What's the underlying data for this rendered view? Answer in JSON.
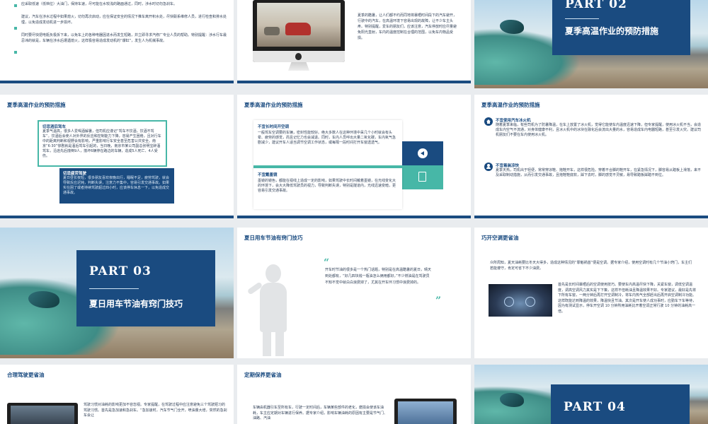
{
  "slides": {
    "s1": {
      "p1": "应采取低速（低档位）大油门，保持车速，尽可能在水较浅的路面通过，同时，涉水时切勿急刹车。",
      "p2": "建议，汽车在涉水过程中如果熄火，切勿再次启动，应在保证安全的情况下推车离开积水处，尽快联系维修人员，进行检查和排水处理，以免造成发动机进一步损坏。",
      "p3": "同时要尽快把电瓶负极拆下来，以免车上的各种电器因进水而发生短路，并立即寻求汽修厂专业人员的帮助。特别提醒：涉水行车最忌讳的就是，车辆在涉水后遭遇熄火，这样极容易造成发动机的“爆缸”，发生人为机械事故。"
    },
    "s2": {
      "text": "夏季的酷暑，让人们都不约而同地将暴晒时间段下的汽车避开，行驶中的汽车，在高温环境下容易出现的故障，让不少车主头疼。特别提醒，爱车的朋友们，应该注意，汽车停放时应尽量避免阳光直射，车内的温度控制在合理的范围，以免车内物品受损。"
    },
    "s3": {
      "part": "PART  02",
      "title": "夏季高温作业的预防措施"
    },
    "s4": {
      "title": "夏季高温作业的预防措施",
      "box1_head": "切忌酒后驾车",
      "box1_text": "夏季气温高，很多人爱喝酒解暑，但司机应谨记“驾车不饮酒，饮酒不驾车”。饮酒后会使人对外界的反应和控制能力下降，容易产生困倦，且对行车中的距离判断和视野会有影响，严重影响行车安全甚至危害公共安全。南京“6·30”惨剧就是酒后驾车引起的，当日晚，南京市某公司副总张明宝醉酒驾车，沿途先后撞倒9人，撞坏6辆停在路边的车辆，造成5人死亡、4人受伤。",
      "box2_head": "切忌疲劳驾驶",
      "box2_text": "夏日昼长夜短，很多朋友喜欢夜晚出行，睡眠不足，疲劳驾驶，就会导致反应迟钝，判断失误，注意力不集中，容易引发交通事故。如果实在困了或者持续驾驶超过四小时，应该停车休息一下，以免造成交通事故。"
    },
    "s5": {
      "title": "夏季高温作业的预防措施",
      "box1_head": "不宜长时间开空调",
      "box1_text": "一般驾车空调要的车辆，密封性能较好。绝大多数人在这种环境中呆几个小时就会有头晕、疲劳的感觉，而且记忆力也会减退。同时，车内人员呼出大量二氧化碳，车内氧气急剧减少，建议开车人适当调节空调工作状态，或每隔一段时间打开车窗透透气。",
      "box2_head": "不宜戴墨镜",
      "box2_text": "墨镜的镜色，都能在视线上造成一定的影响，如果驾驶中长时间戴着墨镜，在光线变化大的环境下，会大大降低驾驶员的视力，导致判断失误，特别是隧道内，光线迅速变暗，更容易引发交通事故。"
    },
    "s6": {
      "title": "夏季高温作业的预防措施",
      "item1_head": "不宜使用汽车冰火机",
      "item1_text": "随着夏季来临，有些司机为了防暑降温，在车上放置了冰火机，觉得它能使车内温度迅速下降，但专家提醒，使用冰火机不当，会造成车内空气不流通，对身体健康不利，且冰火机中的冰块在融化后会流出大量的水，容易造成车内电器短路，甚至引发火灾。建议司机朋友们不要在车内使用冰火机。",
      "item2_head": "不宜着装凉快",
      "item2_text": "夏季天热，司机出于轻便，常常穿凉鞋、拖鞋开车，这样很危险。穿着不合脚的鞋开车，在紧急情况下，脚容易从踏板上滑落，来不及采取制动措施，从而引发交通事故，且拖鞋鞋底软，踩下去时，脚的感觉不灵敏，易导致踏板踩踏不到位。"
    },
    "s7": {
      "part": "PART  03",
      "title": "夏日用车节油有窍门技巧"
    },
    "s8": {
      "title": "夏日用车节油有窍门技巧",
      "quote_text": "开车时节油的很多是一个热门话题，特别是在高温酷暑的夏日，晴天到处都有，“好几四块钱一瓶油怎么俩用都好，”不少燃油是在驾驶员不知不觉中就白白浪费掉了，尤其在开车环习惯中浪费掉的。"
    },
    "s9": {
      "title": "巧开空调更省油",
      "p1": "众所周知，夏天油耗要比冬天大得多，造成这种情况的“罪魁祸首”便是空调。据专家介绍，使用空调时有几个节油小窍门，车主们若能遵守，肯定可省下不少油费。",
      "p2": "首先是长时间暴晒后的空调使用技巧。要使车内高温尽快下降，关紧车窗，调低空调温度，调高空调风力其实是下下策，这样不但耗油且降温效果不好。专家建议，最好是先将下所有车窗，一两分钟后再打开空调制冷，将车内热气全部赶出后再开启空调制冷功能。这样既能达到降温的效果，降温快且节油。其次是开车使人成功事时，应勤车下车等待，因为有测试显示，停车开空调 10 分钟所用油耗比开着空调正常行驶 10 分钟的油耗高一倍。"
    },
    "s10": {
      "title": "合理驾驶更省油",
      "text": "驾驶习惯对油耗的影响更加不容忽视。专家提醒，在驾驶过程中应注意避免三个驾驶陋习的驾驶习惯。首先是急加速和急刹车。“急加速时，汽车节气门全开，喷油量大增，突然的急刹车会让"
    },
    "s11": {
      "title": "定期保养更省油",
      "text": "车辆由机器引车至所有车，行驶一定时间后，车辆某些部件的老化，磨损会使该车油耗，车主应定期对车辆进行保养。据专家介绍，影响车辆油耗的原因有主要是节气门、油路、汽油"
    },
    "s12": {
      "part": "PART  04"
    }
  },
  "colors": {
    "navy": "#1a4b80",
    "teal": "#47b7a7"
  },
  "icons": {
    "house": "house-icon",
    "person": "person-icon",
    "quote": "quote-icon",
    "arrow": "arrow-left-icon",
    "edit": "edit-icon"
  }
}
